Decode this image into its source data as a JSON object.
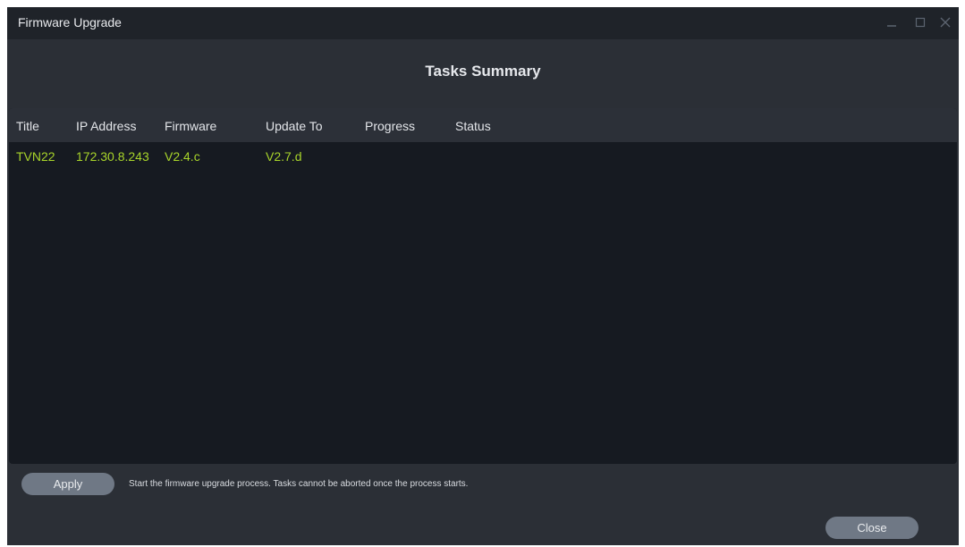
{
  "window": {
    "title": "Firmware Upgrade"
  },
  "heading": "Tasks Summary",
  "table": {
    "columns": [
      "Title",
      "IP Address",
      "Firmware",
      "Update To",
      "Progress",
      "Status"
    ],
    "rows": [
      {
        "title": "TVN22",
        "ip": "172.30.8.243",
        "firmware": "V2.4.c",
        "update_to": "V2.7.d",
        "progress": "",
        "status": ""
      }
    ]
  },
  "footer": {
    "apply_label": "Apply",
    "hint": "Start the firmware upgrade process.  Tasks cannot be aborted once the process starts.",
    "close_label": "Close"
  },
  "icons": {
    "minimize": "minimize-icon",
    "maximize": "maximize-icon",
    "close": "close-icon"
  },
  "colors": {
    "window_bg": "#2b2f36",
    "titlebar_bg": "#1f2329",
    "table_bg": "#161a21",
    "header_bg": "#2c3038",
    "row_text": "#a8d42a",
    "button_bg": "#6f7885"
  }
}
